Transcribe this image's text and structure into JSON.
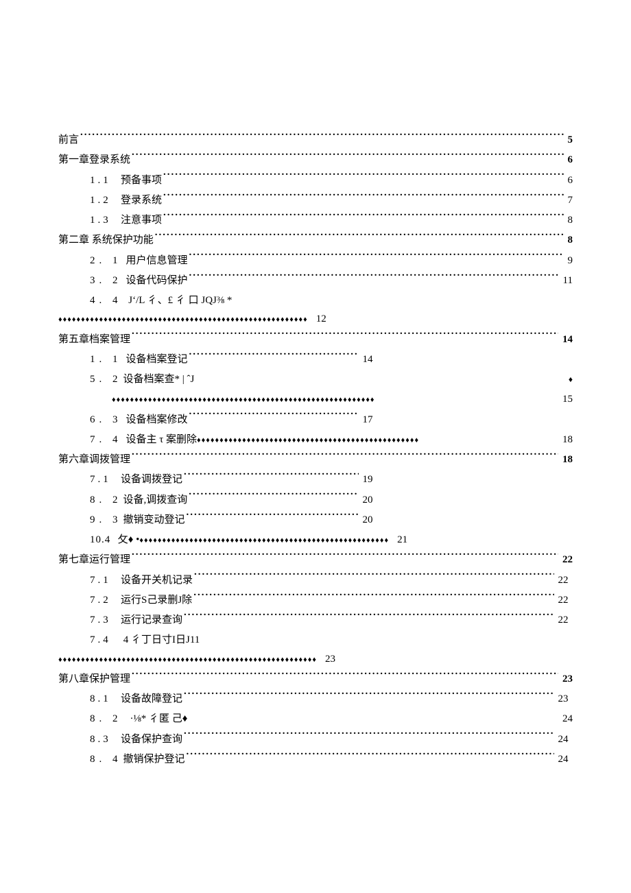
{
  "toc": {
    "e0": {
      "label": "前言",
      "page": "5"
    },
    "e1": {
      "label": "第一章登录系统",
      "page": "6"
    },
    "e2": {
      "num": "1.1",
      "label": "预备事项",
      "page": "6"
    },
    "e3": {
      "num": "1.2",
      "label": "登录系统",
      "page": "7"
    },
    "e4": {
      "num": "1.3",
      "label": "注意事项",
      "page": "8"
    },
    "e5": {
      "label": "第二章  系统保护功能",
      "page": "8"
    },
    "e6": {
      "num": "2. 1",
      "label": "用户信息管理",
      "page": "9"
    },
    "e7": {
      "num": "3. 2",
      "label": "设备代码保护",
      "page": "11"
    },
    "e8": {
      "num": "4. 4",
      "label": "Jʻ/L 彳、£ 彳 口 JQJ⅜  *",
      "page": "12"
    },
    "e9": {
      "label": "第五章档案管理",
      "page": "14"
    },
    "e10": {
      "num": "1. 1",
      "label": "设备档案登记",
      "page": "14"
    },
    "e11": {
      "num": "5. 2",
      "label": "设备档案查* |  ˆJ",
      "page": "15",
      "trail": "♦"
    },
    "e12": {
      "num": "6. 3",
      "label": "设备档案修改",
      "page": "17"
    },
    "e13": {
      "num": "7. 4",
      "label": "设备主 τ  案删除",
      "page": "18"
    },
    "e14": {
      "label": "第六章调拨管理",
      "page": "18"
    },
    "e15": {
      "num": "7.1",
      "label": "设备调拨登记",
      "page": "19"
    },
    "e16": {
      "num": "8. 2",
      "label": "设备,调拨查询",
      "page": "20"
    },
    "e17": {
      "num": "9. 3",
      "label": "撤销变动登记",
      "page": "20"
    },
    "e18": {
      "num": "10.4",
      "label": "攵♦  •",
      "page": "21"
    },
    "e19": {
      "label": "第七章运行管理",
      "page": "22"
    },
    "e20": {
      "num": "7.1",
      "label": "设备开关机记录",
      "page": "22"
    },
    "e21": {
      "num": "7.2",
      "label": "运行S己录删J除",
      "page": "22"
    },
    "e22": {
      "num": "7.3",
      "label": "运行记录查询",
      "page": "22"
    },
    "e23": {
      "num": "7.4",
      "label": "4 彳丁日寸I日J11",
      "page": "23"
    },
    "e24": {
      "label": "第八章保护管理",
      "page": "23"
    },
    "e25": {
      "num": "8.1",
      "label": "设备故障登记",
      "page": "23"
    },
    "e26": {
      "num": "8. 2",
      "label": "·⅛* 彳匿   己♦",
      "page": "24"
    },
    "e27": {
      "num": "8.3",
      "label": "设备保护查询",
      "page": "24"
    },
    "e28": {
      "num": "8. 4",
      "label": "撤销保护登记",
      "page": "24"
    }
  },
  "diamonds": {
    "d_e8": "♦♦♦♦♦♦♦♦♦♦♦♦♦♦♦♦♦♦♦♦♦♦♦♦♦♦♦♦♦♦♦♦♦♦♦♦♦♦♦♦♦♦♦♦♦♦♦♦♦♦♦♦♦♦♦",
    "d_e11": "♦♦♦♦♦♦♦♦♦♦♦♦♦♦♦♦♦♦♦♦♦♦♦♦♦♦♦♦♦♦♦♦♦♦♦♦♦♦♦♦♦♦♦♦♦♦♦♦♦♦♦♦♦♦♦♦♦♦",
    "d_e13": "♦♦♦♦♦♦♦♦♦♦♦♦♦♦♦♦♦♦♦♦♦♦♦♦♦♦♦♦♦♦♦♦♦♦♦♦♦♦♦♦♦♦♦♦♦♦♦♦♦",
    "d_e18": "♦♦♦♦♦♦♦♦♦♦♦♦♦♦♦♦♦♦♦♦♦♦♦♦♦♦♦♦♦♦♦♦♦♦♦♦♦♦♦♦♦♦♦♦♦♦♦♦♦♦♦♦♦♦♦",
    "d_e23": "♦♦♦♦♦♦♦♦♦♦♦♦♦♦♦♦♦♦♦♦♦♦♦♦♦♦♦♦♦♦♦♦♦♦♦♦♦♦♦♦♦♦♦♦♦♦♦♦♦♦♦♦♦♦♦♦♦"
  }
}
